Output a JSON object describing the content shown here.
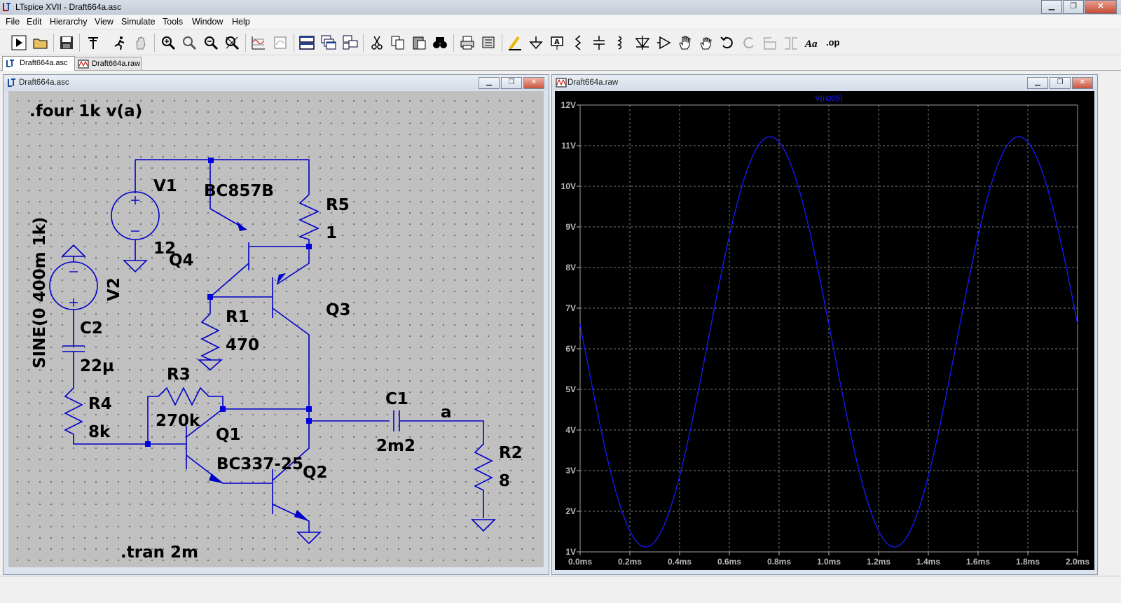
{
  "app": {
    "title": "LTspice XVII - Draft664a.asc",
    "menu": [
      "File",
      "Edit",
      "Hierarchy",
      "View",
      "Simulate",
      "Tools",
      "Window",
      "Help"
    ]
  },
  "tabs": [
    {
      "label": "Draft664a.asc",
      "active": true
    },
    {
      "label": "Draft664a.raw",
      "active": false
    }
  ],
  "schematic_window": {
    "title": "Draft664a.asc",
    "directives": {
      "four": ".four 1k v(a)",
      "tran": ".tran 2m"
    },
    "components": {
      "V1": {
        "name": "V1",
        "value": "12"
      },
      "V2": {
        "name": "V2",
        "value": "SINE(0 400m 1k)"
      },
      "C1": {
        "name": "C1",
        "value": "2m2"
      },
      "C2": {
        "name": "C2",
        "value": "22µ"
      },
      "R1": {
        "name": "R1",
        "value": "470"
      },
      "R2": {
        "name": "R2",
        "value": "8"
      },
      "R3": {
        "name": "R3",
        "value": "270k"
      },
      "R4": {
        "name": "R4",
        "value": "8k"
      },
      "R5": {
        "name": "R5",
        "value": "1"
      },
      "Q1": {
        "name": "Q1"
      },
      "Q2": {
        "name": "Q2"
      },
      "Q3": {
        "name": "Q3"
      },
      "Q4": {
        "name": "Q4"
      },
      "model_pnp": "BC857B",
      "model_npn": "BC337-25"
    },
    "net_label": "a"
  },
  "plot_window": {
    "title": "Draft664a.raw"
  },
  "chart_data": {
    "type": "line",
    "title": "",
    "series": [
      {
        "name": "V(n005)",
        "color": "#1a1aff",
        "amplitude": 5.05,
        "offset": 6.17,
        "frequency_hz": 1000,
        "phase": "cosine-shift",
        "x": [
          0,
          0.0001,
          0.00025,
          0.0005,
          0.00075,
          0.001,
          0.00125,
          0.0015,
          0.00175,
          0.002
        ],
        "y": [
          6.6,
          4.8,
          1.12,
          6.17,
          11.22,
          6.17,
          1.12,
          6.17,
          11.22,
          6.7
        ]
      }
    ],
    "x_ticks": [
      "0.0ms",
      "0.2ms",
      "0.4ms",
      "0.6ms",
      "0.8ms",
      "1.0ms",
      "1.2ms",
      "1.4ms",
      "1.6ms",
      "1.8ms",
      "2.0ms"
    ],
    "y_ticks": [
      "1V",
      "2V",
      "3V",
      "4V",
      "5V",
      "6V",
      "7V",
      "8V",
      "9V",
      "10V",
      "11V",
      "12V"
    ],
    "xlim": [
      0,
      0.002
    ],
    "ylim": [
      1,
      12
    ],
    "grid": true,
    "trace_color": "#1a1aff",
    "background": "#000000",
    "grid_color": "#a0a0a0"
  }
}
